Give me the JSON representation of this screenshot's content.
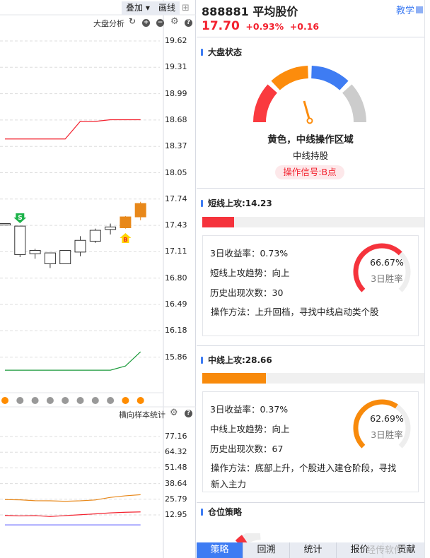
{
  "toolbar": {
    "overlay": "叠加",
    "draw": "画线",
    "market_analysis": "大盘分析",
    "sample_stats": "横向样本统计"
  },
  "price_axis": [
    "19.62",
    "19.31",
    "18.99",
    "18.68",
    "18.37",
    "18.05",
    "17.74",
    "17.43",
    "17.11",
    "16.80",
    "16.49",
    "16.18",
    "15.86"
  ],
  "lower_axis": [
    "77.16",
    "64.32",
    "51.48",
    "38.64",
    "25.79",
    "12.95"
  ],
  "chart_data": {
    "type": "candlestick",
    "ylim": [
      15.86,
      19.62
    ],
    "candles": [
      [
        17.44,
        17.45,
        17.45,
        17.44
      ],
      [
        17.41,
        17.41,
        17.04,
        17.07
      ],
      [
        17.12,
        17.14,
        17.02,
        17.08
      ],
      [
        17.09,
        17.09,
        16.91,
        16.96
      ],
      [
        16.96,
        17.12,
        16.96,
        17.12
      ],
      [
        17.1,
        17.29,
        17.05,
        17.24
      ],
      [
        17.23,
        17.38,
        17.21,
        17.36
      ],
      [
        17.37,
        17.44,
        17.31,
        17.4
      ],
      [
        17.39,
        17.53,
        17.38,
        17.52
      ],
      [
        17.52,
        17.7,
        17.48,
        17.68
      ]
    ],
    "red_line": [
      18.45,
      18.45,
      18.45,
      18.45,
      18.45,
      18.66,
      18.66,
      18.68,
      18.68,
      18.68
    ],
    "green_line": [
      15.69,
      15.69,
      15.69,
      15.69,
      15.69,
      15.69,
      15.69,
      15.69,
      15.74,
      15.91
    ],
    "signals": [
      {
        "index": 1,
        "type": "S"
      },
      {
        "index": 8,
        "type": "B"
      }
    ],
    "dots": [
      "orange",
      "gray",
      "gray",
      "gray",
      "gray",
      "gray",
      "gray",
      "gray",
      "orange",
      "orange"
    ],
    "lower": {
      "ylim": [
        0,
        77.16
      ],
      "orange": [
        25.5,
        25.3,
        24.6,
        24.5,
        24.1,
        24.5,
        25.2,
        27.3,
        28.6,
        29.5
      ],
      "red": [
        12.5,
        12.2,
        12.4,
        11.6,
        12.4,
        13.1,
        13.8,
        14.6,
        15.1,
        15.4
      ],
      "blue": [
        4.8,
        4.8,
        4.8,
        4.8,
        4.8,
        4.8,
        4.8,
        4.8,
        4.8,
        4.8
      ]
    }
  },
  "header": {
    "title": "888881 平均股价",
    "teach": "教学",
    "price": "17.70",
    "pct": "+0.93%",
    "change": "+0.16"
  },
  "market": {
    "title": "大盘状态",
    "status": "黄色，中线操作区域",
    "advice": "中线持股",
    "signal": "操作信号:B点"
  },
  "short": {
    "title": "短线上攻:14.23",
    "progress": 14.23,
    "color": "#f5333c",
    "ret": "3日收益率：0.73%",
    "trend": "短线上攻趋势：向上",
    "count": "历史出现次数：30",
    "method": "操作方法：上升回档，寻找中线启动类个股",
    "rate": "66.67%",
    "rate_value": 66.67,
    "rate_label": "3日胜率"
  },
  "mid": {
    "title": "中线上攻:28.66",
    "progress": 28.66,
    "color": "#f88a0b",
    "ret": "3日收益率：0.37%",
    "trend": "中线上攻趋势：向上",
    "count": "历史出现次数：67",
    "method1": "操作方法：底部上升，个股进入建仓阶段，寻找",
    "method2": "新入主力",
    "rate": "62.69%",
    "rate_value": 62.69,
    "rate_label": "3日胜率"
  },
  "position": {
    "title": "仓位策略"
  },
  "tabs": [
    "策略",
    "回溯",
    "统计",
    "报价",
    "贡献"
  ],
  "watermark": "经传软件"
}
